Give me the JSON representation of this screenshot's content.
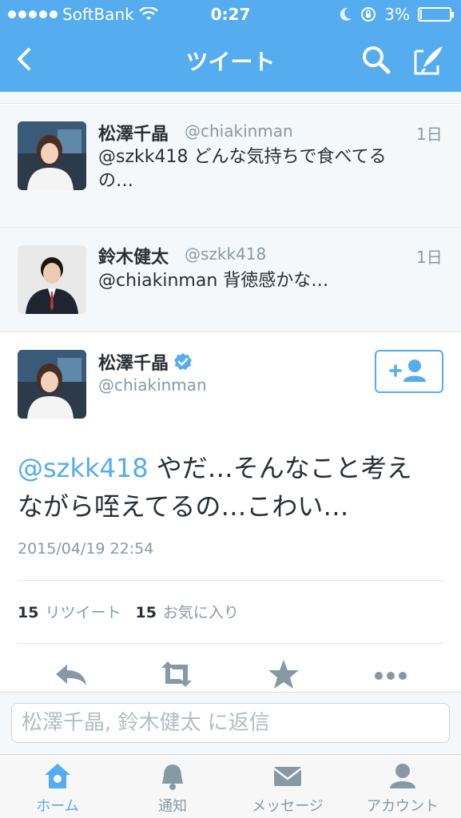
{
  "status_bar": {
    "carrier": "SoftBank",
    "time": "0:27",
    "battery": "3%"
  },
  "nav": {
    "title": "ツイート"
  },
  "tweets": [
    {
      "name": "松澤千晶",
      "handle": "@chiakinman",
      "time": "1日",
      "text_line1": "@szkk418 どんな気持ちで食べてる",
      "text_line2": "の…"
    },
    {
      "name": "鈴木健太",
      "handle": "@szkk418",
      "time": "1日",
      "text_line1": "@chiakinman 背徳感かな…"
    }
  ],
  "detail": {
    "name": "松澤千晶",
    "handle": "@chiakinman",
    "mention": "@szkk418",
    "text_rest": " やだ…そんなこと考え",
    "text_line2": "ながら咥えてるの…こわい…",
    "timestamp": "2015/04/19 22:54",
    "retweet_count": "15",
    "retweet_label": "リツイート",
    "fav_count": "15",
    "fav_label": "お気に入り"
  },
  "reply": {
    "placeholder": "松澤千晶, 鈴木健太 に返信"
  },
  "tabs": [
    {
      "label": "ホーム",
      "active": true
    },
    {
      "label": "通知"
    },
    {
      "label": "メッセージ"
    },
    {
      "label": "アカウント"
    }
  ],
  "colors": {
    "brand": "#55acee",
    "muted": "#8899a6",
    "action_icon": "#8899a6"
  }
}
